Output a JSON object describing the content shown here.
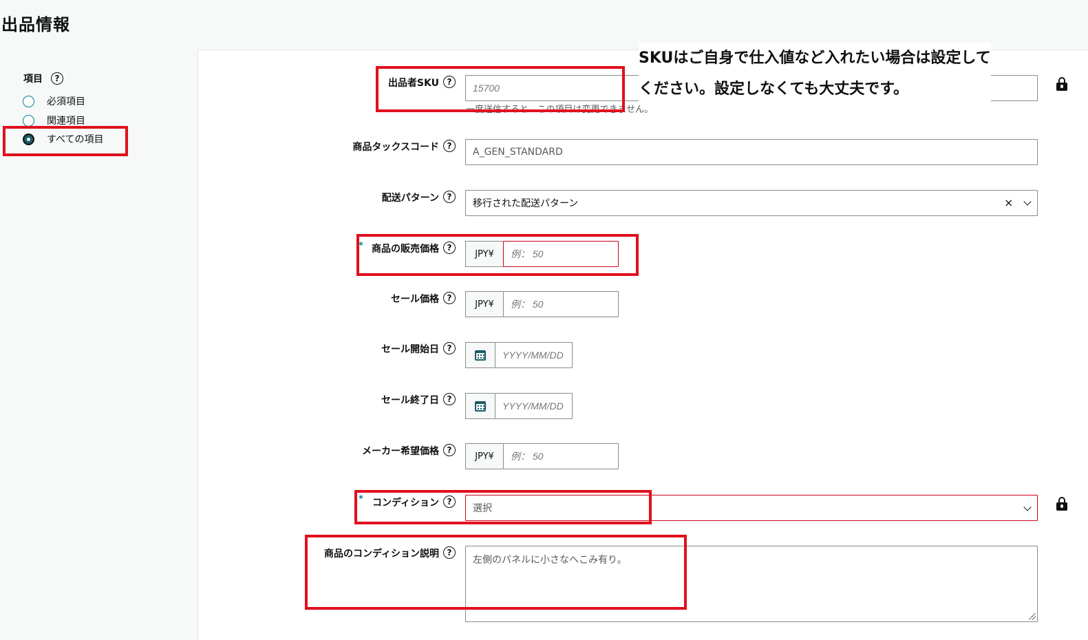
{
  "page": {
    "title": "出品情報"
  },
  "sidebar": {
    "heading": "項目",
    "options": [
      {
        "label": "必須項目",
        "checked": false
      },
      {
        "label": "関連項目",
        "checked": false
      },
      {
        "label": "すべての項目",
        "checked": true
      }
    ]
  },
  "annotation": {
    "line1": "SKUはご自身で仕入値など入れたい場合は設定して",
    "line2": "ください。設定しなくても大丈夫です。"
  },
  "form": {
    "sku": {
      "label": "出品者SKU",
      "placeholder": "15700",
      "hint": "一度送信すると、この項目は変更できません。"
    },
    "tax_code": {
      "label": "商品タックスコード",
      "value": "A_GEN_STANDARD"
    },
    "shipping": {
      "label": "配送パターン",
      "value": "移行された配送パターン",
      "clear": "×"
    },
    "price": {
      "label": "商品の販売価格",
      "currency": "JPY¥",
      "placeholder": "例： 50",
      "required_mark": "*"
    },
    "sale_price": {
      "label": "セール価格",
      "currency": "JPY¥",
      "placeholder": "例： 50"
    },
    "sale_start": {
      "label": "セール開始日",
      "placeholder": "YYYY/MM/DD"
    },
    "sale_end": {
      "label": "セール終了日",
      "placeholder": "YYYY/MM/DD"
    },
    "msrp": {
      "label": "メーカー希望価格",
      "currency": "JPY¥",
      "placeholder": "例： 50"
    },
    "condition": {
      "label": "コンディション",
      "value": "選択",
      "required_mark": "*"
    },
    "condition_note": {
      "label": "商品のコンディション説明",
      "value": "左側のパネルに小さなへこみ有り。"
    }
  },
  "colors": {
    "accent": "#008296",
    "annotation_box": "#e0101e",
    "error": "#d0021b"
  }
}
